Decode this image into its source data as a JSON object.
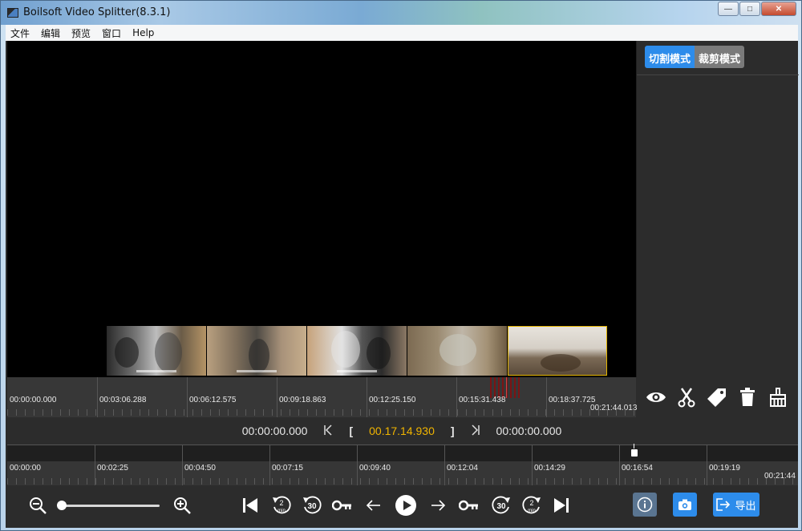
{
  "window": {
    "title": "Boilsoft Video Splitter(8.3.1)"
  },
  "menu": [
    "文件",
    "编辑",
    "预览",
    "窗口",
    "Help"
  ],
  "modes": {
    "active": "切割模式",
    "inactive": "裁剪模式"
  },
  "upper_timeline": {
    "labels": [
      "00:00:00.000",
      "00:03:06.288",
      "00:06:12.575",
      "00:09:18.863",
      "00:12:25.150",
      "00:15:31.438",
      "00:18:37.725"
    ],
    "end_label": "00:21:44.013"
  },
  "tools": [
    "eye-icon",
    "scissors-icon",
    "tag-icon",
    "trash-icon",
    "broom-icon"
  ],
  "time_row": {
    "start": "00:00:00.000",
    "current": "00.17.14.930",
    "end": "00:00:00.000",
    "open_bracket": "[",
    "close_bracket": "]"
  },
  "lower_timeline": {
    "labels": [
      "00:00:00",
      "00:02:25",
      "00:04:50",
      "00:07:15",
      "00:09:40",
      "00:12:04",
      "00:14:29",
      "00:16:54",
      "00:19:19"
    ],
    "end_label": "00:21:44"
  },
  "toolbar": {
    "export_label": "导出",
    "jump_2min": "2",
    "jump_2min_unit": "min",
    "jump_30": "30"
  },
  "colors": {
    "accent": "#2d8ceb",
    "time_highlight": "#f0b400"
  }
}
